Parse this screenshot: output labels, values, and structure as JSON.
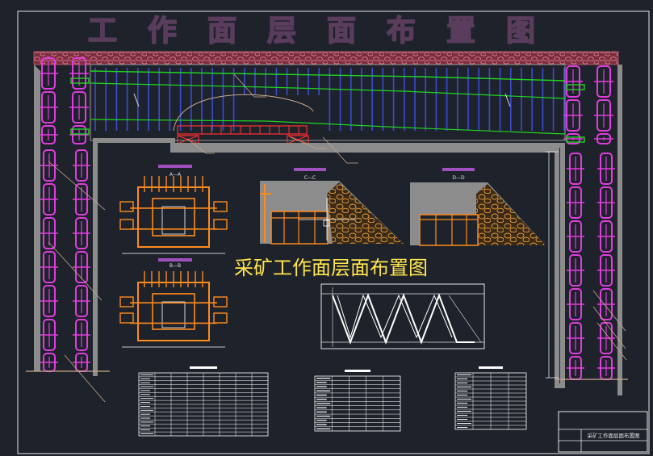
{
  "drawing": {
    "header_title": "工作面层面布置图",
    "overlay_label": "采矿工作面层面布置图",
    "title_block_text": "采矿工作面层面布置图"
  },
  "sections": {
    "a_a": "A—A",
    "b_b": "B—B",
    "c_c": "C—C",
    "d_d": "D—D"
  },
  "colors": {
    "background": "#1e232b",
    "roof_rock": "#c8637a",
    "supports": "#e23ce0",
    "hydraulic_props": "#3a4bd8",
    "strata_line": "#22d422",
    "equipment": "#ff8a1e",
    "section_fill": "#8c8c8c",
    "callout": "#c9a98a",
    "label": "#ffe44d",
    "linework": "#ffffff"
  }
}
